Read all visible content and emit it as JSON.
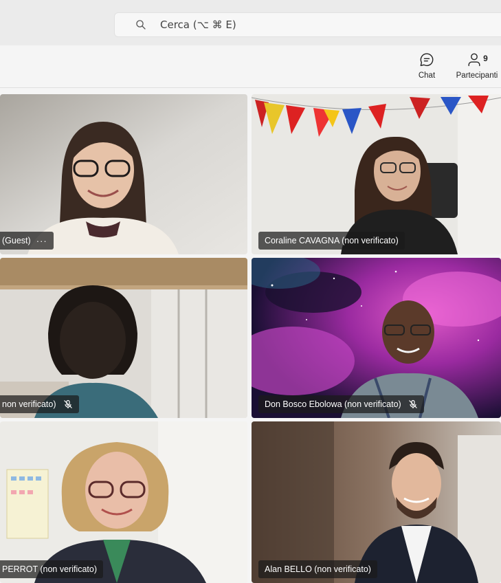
{
  "search": {
    "text": "Cerca (⌥ ⌘ E)"
  },
  "toolbar": {
    "chat_label": "Chat",
    "participants_label": "Partecipanti",
    "participants_count": "9"
  },
  "tiles": [
    {
      "name": "(Guest)",
      "more": "···",
      "muted": false
    },
    {
      "name": "Coraline CAVAGNA (non verificato)",
      "muted": false
    },
    {
      "name": "non verificato)",
      "muted": true
    },
    {
      "name": "Don Bosco Ebolowa (non verificato)",
      "muted": true
    },
    {
      "name": "PERROT (non verificato)",
      "muted": false
    },
    {
      "name": "Alan BELLO (non verificato)",
      "muted": false
    }
  ],
  "colors": {
    "accent": "#242424",
    "tag_bg": "#1a1a1a"
  }
}
